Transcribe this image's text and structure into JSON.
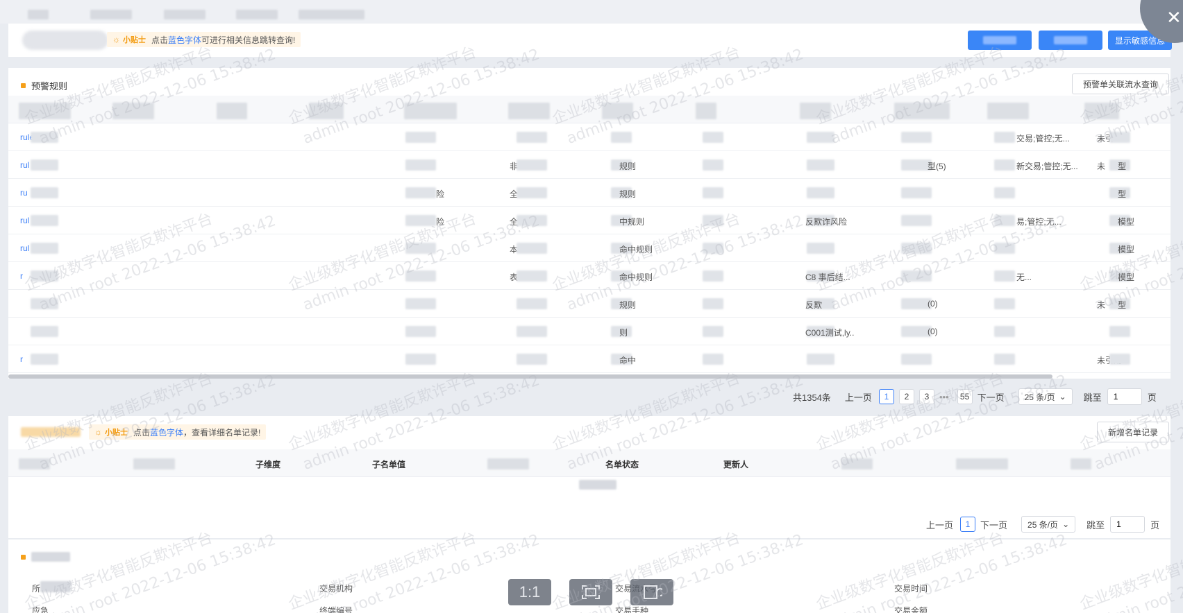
{
  "close_icon": "✕",
  "header": {
    "tip_tag": "小贴士",
    "tip_prefix": "点击",
    "tip_link": "蓝色字体",
    "tip_suffix": "可进行相关信息跳转查询!",
    "show_sensitive_label": "显示敏感信息"
  },
  "section1": {
    "title": "预警规则",
    "linked_query_label": "预警单关联流水查询",
    "rows": [
      {
        "id": "rule1",
        "c7": "",
        "c10": "交易;管控;无...",
        "c11": "未引"
      },
      {
        "id": "rul",
        "c7": "",
        "c10": "新交易;管控;无...",
        "c11": "未"
      },
      {
        "id": "ru",
        "c7": "",
        "c10": "",
        "c11": ""
      },
      {
        "id": "rul",
        "c7": "反欺诈风险",
        "c10": "易;管控;无...",
        "c11": ""
      },
      {
        "id": "rul",
        "c7": "",
        "c10": "",
        "c11": ""
      },
      {
        "id": "r",
        "c7": "C8 事后结...",
        "c10": "无...",
        "c11": ""
      },
      {
        "id": "",
        "c7": "反欺",
        "c10": "",
        "c11": "未"
      },
      {
        "id": "",
        "c7": "C001测试,ly..",
        "c10": "",
        "c11": ""
      },
      {
        "id": "r",
        "c7": "",
        "c10": "",
        "c11": "未引用"
      }
    ],
    "col3": [
      "",
      "",
      "险",
      "险",
      "",
      "",
      "",
      "",
      ""
    ],
    "col4": [
      "",
      "非",
      "全",
      "全",
      "本",
      "表",
      "",
      "",
      ""
    ],
    "col5": [
      "",
      "规则",
      "规则",
      "中规则",
      "命中规则",
      "命中规则",
      "规则",
      "则",
      "命中"
    ],
    "col8": [
      "",
      "型(5)",
      "",
      "",
      "",
      "",
      "(0)",
      "(0)",
      ""
    ],
    "col11": [
      "",
      "型",
      "型",
      "模型",
      "模型",
      "模型",
      "型",
      "",
      ""
    ],
    "pager": {
      "total": "共1354条",
      "prev": "上一页",
      "pages": [
        "1",
        "2",
        "3"
      ],
      "ellipsis": "•••",
      "last": "55",
      "next": "下一页",
      "size": "25 条/页",
      "jump_label": "跳至",
      "jump_value": "1",
      "page_unit": "页"
    }
  },
  "section2": {
    "tip_tag": "小贴士",
    "tip_prefix": "点击",
    "tip_link": "蓝色字体",
    "tip_suffix": "，查看详细名单记录!",
    "add_record_label": "新增名单记录",
    "headers": {
      "h3": "子维度",
      "h4": "子名单值",
      "h6": "名单状态",
      "h7": "更新人"
    },
    "pager": {
      "prev": "上一页",
      "page": "1",
      "next": "下一页",
      "size": "25 条/页",
      "jump_label": "跳至",
      "jump_value": "1",
      "page_unit": "页"
    }
  },
  "section3": {
    "fields": {
      "f1": "所",
      "f2": "交易机构",
      "f3": "交易流水号",
      "f4": "交易时间",
      "f5": "应急",
      "f6": "终端编号",
      "f7": "交易手种",
      "f8": "交易金额"
    }
  },
  "viewer": {
    "one_to_one": "1:1"
  },
  "watermark": {
    "line1": "企业级数字化智能反欺诈平台",
    "line2": "admin root 2022-12-06 15:38:42"
  }
}
